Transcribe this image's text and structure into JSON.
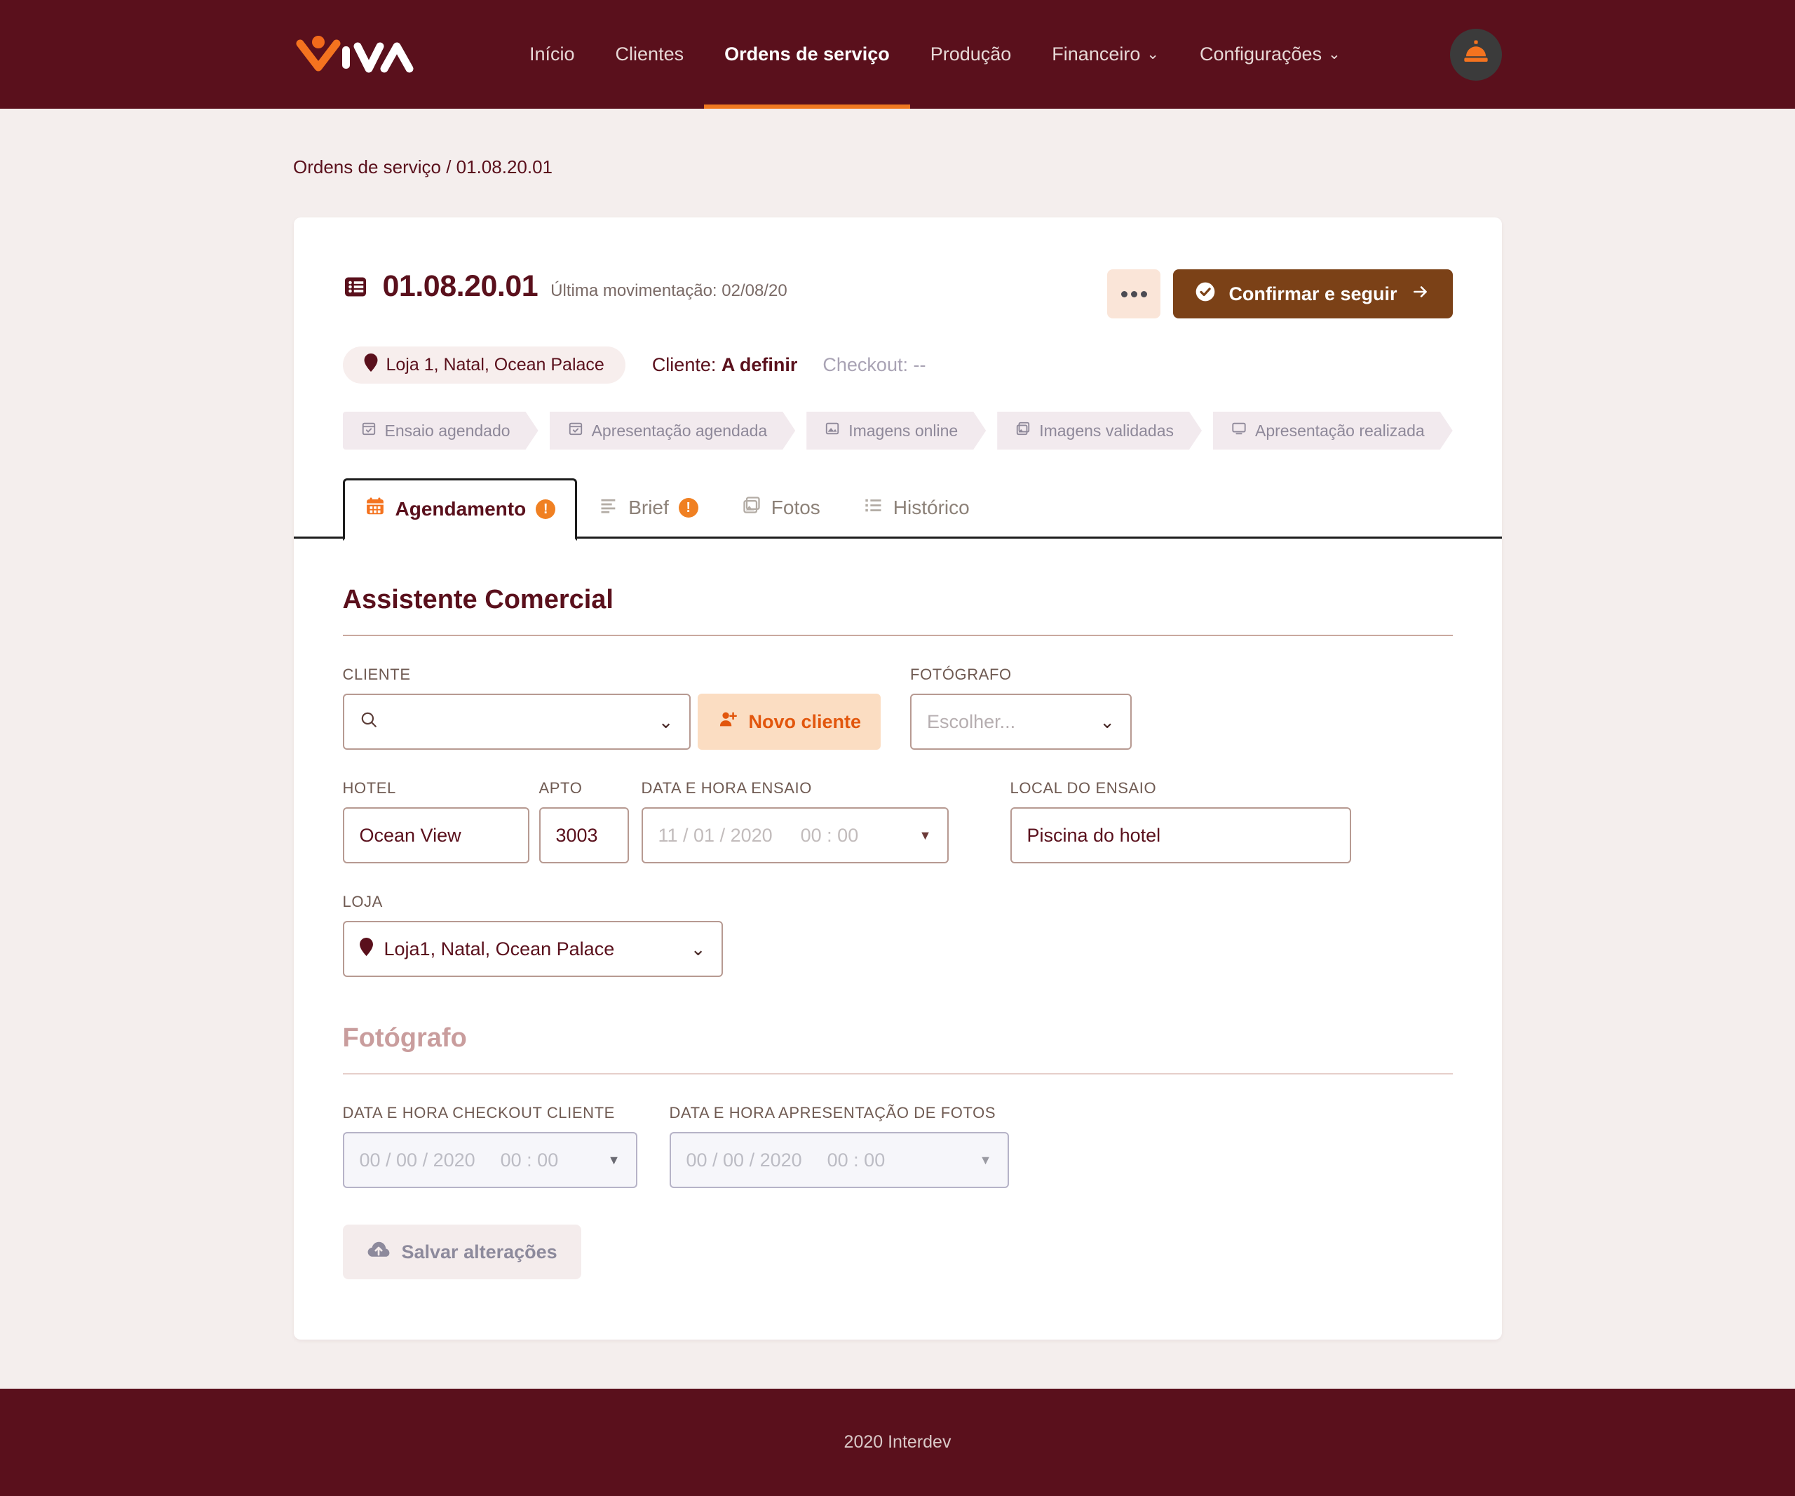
{
  "brand": {
    "logo_text": "VIVA",
    "accent": "#f07820",
    "primary": "#5a101c"
  },
  "nav": {
    "items": [
      {
        "label": "Início",
        "active": false,
        "has_caret": false
      },
      {
        "label": "Clientes",
        "active": false,
        "has_caret": false
      },
      {
        "label": "Ordens de serviço",
        "active": true,
        "has_caret": false
      },
      {
        "label": "Produção",
        "active": false,
        "has_caret": false
      },
      {
        "label": "Financeiro",
        "active": false,
        "has_caret": true
      },
      {
        "label": "Configurações",
        "active": false,
        "has_caret": true
      }
    ],
    "caret_glyph": "⌄",
    "avatar_icon": "service-bell-icon"
  },
  "breadcrumb": "Ordens de serviço / 01.08.20.01",
  "order": {
    "icon": "list-table-icon",
    "number": "01.08.20.01",
    "last_movement": "Última movimentação: 02/08/20",
    "more_button": "•••",
    "confirm_button": "Confirmar e seguir",
    "store_badge": "Loja 1, Natal, Ocean Palace",
    "client_label": "Cliente:",
    "client_value": "A definir",
    "checkout_label": "Checkout:",
    "checkout_value": "--"
  },
  "stepper": [
    {
      "label": "Ensaio agendado",
      "icon": "calendar-check-icon"
    },
    {
      "label": "Apresentação agendada",
      "icon": "calendar-check-icon"
    },
    {
      "label": "Imagens online",
      "icon": "image-icon"
    },
    {
      "label": "Imagens validadas",
      "icon": "images-icon"
    },
    {
      "label": "Apresentação realizada",
      "icon": "monitor-icon"
    }
  ],
  "tabs": [
    {
      "label": "Agendamento",
      "icon": "calendar-icon",
      "active": true,
      "badge": "!"
    },
    {
      "label": "Brief",
      "icon": "list-lines-icon",
      "active": false,
      "badge": "!"
    },
    {
      "label": "Fotos",
      "icon": "photos-icon",
      "active": false,
      "badge": ""
    },
    {
      "label": "Histórico",
      "icon": "list-bullets-icon",
      "active": false,
      "badge": ""
    }
  ],
  "commercial": {
    "title": "Assistente Comercial",
    "cliente_label": "CLIENTE",
    "cliente_value": "",
    "cliente_placeholder": "",
    "new_client_button": "Novo cliente",
    "fotografo_label": "FOTÓGRAFO",
    "fotografo_placeholder": "Escolher...",
    "hotel_label": "HOTEL",
    "hotel_value": "Ocean View",
    "apto_label": "APTO",
    "apto_value": "3003",
    "ensaio_label": "DATA E HORA ENSAIO",
    "ensaio_date_placeholder": "11 / 01 / 2020",
    "ensaio_time_placeholder": "00 : 00",
    "local_label": "LOCAL DO ENSAIO",
    "local_value": "Piscina do hotel",
    "loja_label": "LOJA",
    "loja_value": "Loja1, Natal, Ocean Palace"
  },
  "photographer": {
    "title": "Fotógrafo",
    "checkout_label": "DATA E HORA CHECKOUT CLIENTE",
    "checkout_date_placeholder": "00 / 00 / 2020",
    "checkout_time_placeholder": "00 : 00",
    "apresentacao_label": "DATA E HORA APRESENTAÇÃO DE FOTOS",
    "apresentacao_date_placeholder": "00 / 00 / 2020",
    "apresentacao_time_placeholder": "00 : 00",
    "save_button": "Salvar alterações"
  },
  "footer": "2020 Interdev"
}
